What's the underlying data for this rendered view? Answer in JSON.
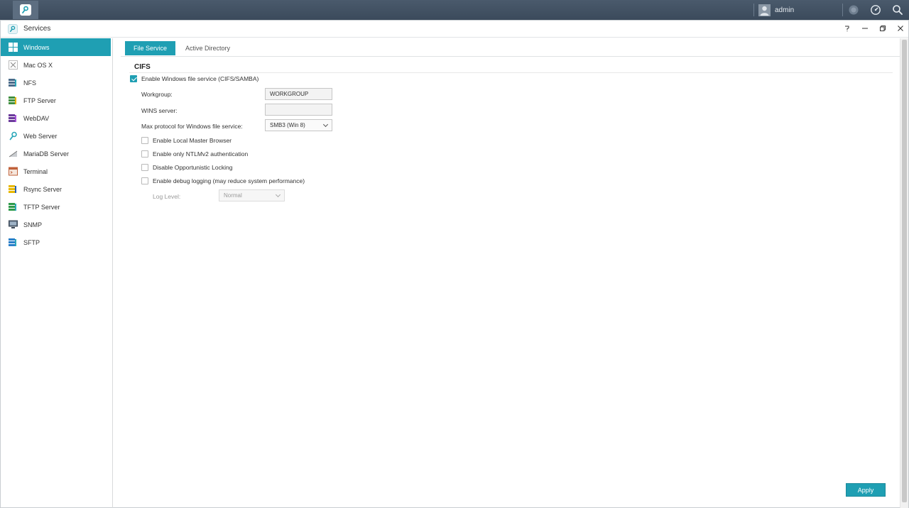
{
  "taskbar": {
    "user": "admin"
  },
  "window": {
    "title": "Services"
  },
  "sidebar": {
    "items": [
      {
        "label": "Windows",
        "icon": "windows-icon"
      },
      {
        "label": "Mac OS X",
        "icon": "mac-icon"
      },
      {
        "label": "NFS",
        "icon": "nfs-icon"
      },
      {
        "label": "FTP Server",
        "icon": "ftp-icon"
      },
      {
        "label": "WebDAV",
        "icon": "webdav-icon"
      },
      {
        "label": "Web Server",
        "icon": "web-server-icon"
      },
      {
        "label": "MariaDB Server",
        "icon": "mariadb-icon"
      },
      {
        "label": "Terminal",
        "icon": "terminal-icon"
      },
      {
        "label": "Rsync Server",
        "icon": "rsync-icon"
      },
      {
        "label": "TFTP Server",
        "icon": "tftp-icon"
      },
      {
        "label": "SNMP",
        "icon": "snmp-icon"
      },
      {
        "label": "SFTP",
        "icon": "sftp-icon"
      }
    ]
  },
  "tabs": [
    {
      "label": "File Service"
    },
    {
      "label": "Active Directory"
    }
  ],
  "cifs": {
    "title": "CIFS",
    "enable_label": "Enable Windows file service (CIFS/SAMBA)",
    "enable_checked": true,
    "workgroup_label": "Workgroup:",
    "workgroup_value": "WORKGROUP",
    "wins_label": "WINS server:",
    "wins_value": "",
    "max_protocol_label": "Max protocol for Windows file service:",
    "max_protocol_value": "SMB3 (Win 8)",
    "options": [
      {
        "label": "Enable Local Master Browser",
        "checked": false
      },
      {
        "label": "Enable only NTLMv2 authentication",
        "checked": false
      },
      {
        "label": "Disable Opportunistic Locking",
        "checked": false
      },
      {
        "label": "Enable debug logging (may reduce system performance)",
        "checked": false
      }
    ],
    "log_level_label": "Log Level:",
    "log_level_value": "Normal"
  },
  "footer": {
    "apply_label": "Apply"
  },
  "colors": {
    "accent": "#1f9fb3",
    "taskbar": "#3f4e60"
  }
}
